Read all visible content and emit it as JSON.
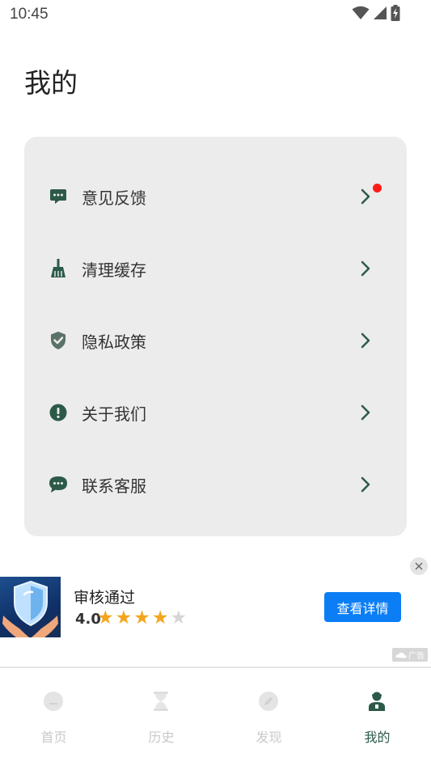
{
  "status_bar": {
    "time": "10:45"
  },
  "page": {
    "title": "我的"
  },
  "menu": {
    "items": [
      {
        "label": "意见反馈",
        "icon": "feedback-chat-icon",
        "has_badge": true
      },
      {
        "label": "清理缓存",
        "icon": "broom-icon",
        "has_badge": false
      },
      {
        "label": "隐私政策",
        "icon": "shield-check-icon",
        "has_badge": false
      },
      {
        "label": "关于我们",
        "icon": "info-exclamation-icon",
        "has_badge": false
      },
      {
        "label": "联系客服",
        "icon": "customer-service-chat-icon",
        "has_badge": false
      }
    ]
  },
  "ad": {
    "title": "审核通过",
    "rating": "4.0",
    "stars_filled": 4,
    "stars_total": 5,
    "cta_label": "查看详情",
    "tag_label": "广告"
  },
  "tabs": [
    {
      "label": "首页",
      "icon": "home-icon",
      "active": false
    },
    {
      "label": "历史",
      "icon": "hourglass-icon",
      "active": false
    },
    {
      "label": "发现",
      "icon": "compass-icon",
      "active": false
    },
    {
      "label": "我的",
      "icon": "profile-icon",
      "active": true
    }
  ],
  "colors": {
    "accent": "#2c5a48",
    "badge": "#ff1a1a",
    "cta": "#0b7ef5",
    "card_bg": "#ececec",
    "star": "#f4a51c"
  }
}
